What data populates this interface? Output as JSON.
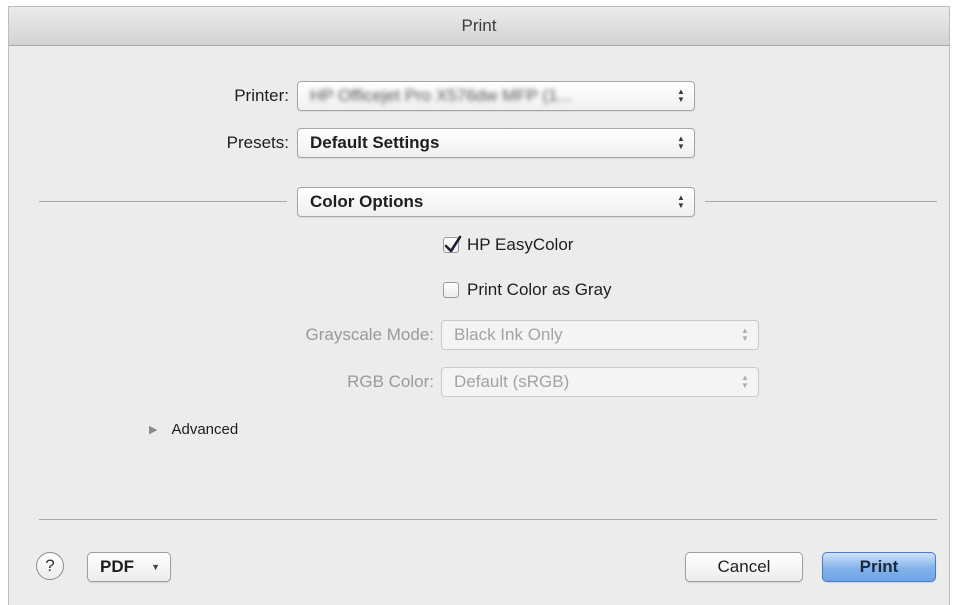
{
  "window": {
    "title": "Print"
  },
  "printer": {
    "label": "Printer:",
    "value": "HP Officejet Pro X576dw MFP (1..."
  },
  "presets": {
    "label": "Presets:",
    "value": "Default Settings"
  },
  "section_popup": {
    "value": "Color Options"
  },
  "hp_easycolor": {
    "label": "HP EasyColor",
    "checked": true
  },
  "print_color_as_gray": {
    "label": "Print Color as Gray",
    "checked": false
  },
  "grayscale_mode": {
    "label": "Grayscale Mode:",
    "value": "Black Ink Only",
    "enabled": false
  },
  "rgb_color": {
    "label": "RGB Color:",
    "value": "Default (sRGB)",
    "enabled": false
  },
  "advanced": {
    "label": "Advanced",
    "expanded": false
  },
  "footer": {
    "help_symbol": "?",
    "pdf_label": "PDF",
    "cancel_label": "Cancel",
    "print_label": "Print"
  },
  "icons": {
    "stepper": "updown-arrows-icon",
    "disclosure": "disclosure-triangle-icon",
    "check": "checkmark-icon",
    "dropdown": "chevron-down-icon"
  }
}
